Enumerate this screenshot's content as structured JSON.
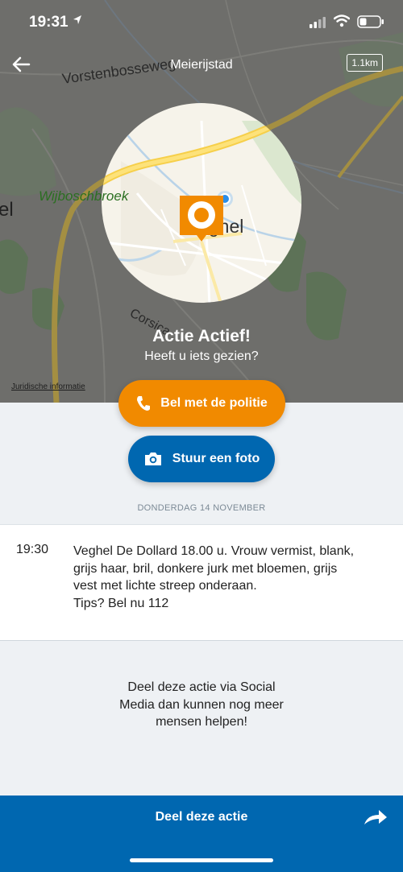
{
  "status": {
    "time": "19:31"
  },
  "nav": {
    "title": "Meierijstad",
    "scale": "1.1km"
  },
  "map": {
    "labels": {
      "road_top": "Vorstenbosseweg",
      "area_left": "Wijboschbroek",
      "town": "Veghel",
      "left_edge": "el",
      "road_bottom": "Corsica"
    },
    "legal": "Juridische informatie"
  },
  "alert": {
    "title": "Actie Actief!",
    "subtitle": "Heeft u iets gezien?"
  },
  "buttons": {
    "call": "Bel met de politie",
    "photo": "Stuur een foto"
  },
  "message": {
    "date": "DONDERDAG 14 NOVEMBER",
    "time": "19:30",
    "lines": [
      "Veghel De Dollard 18.00 u. Vrouw vermist, blank,",
      "grijs haar, bril, donkere jurk met bloemen, grijs",
      "vest met lichte streep onderaan.",
      "Tips? Bel nu 112"
    ]
  },
  "share": {
    "hint_lines": [
      "Deel deze actie via Social",
      "Media dan kunnen nog meer",
      "mensen helpen!"
    ],
    "button": "Deel deze actie"
  },
  "colors": {
    "orange": "#f18a00",
    "blue": "#0067b0",
    "map_dim": "#6e6e6b",
    "background": "#eef1f4"
  }
}
